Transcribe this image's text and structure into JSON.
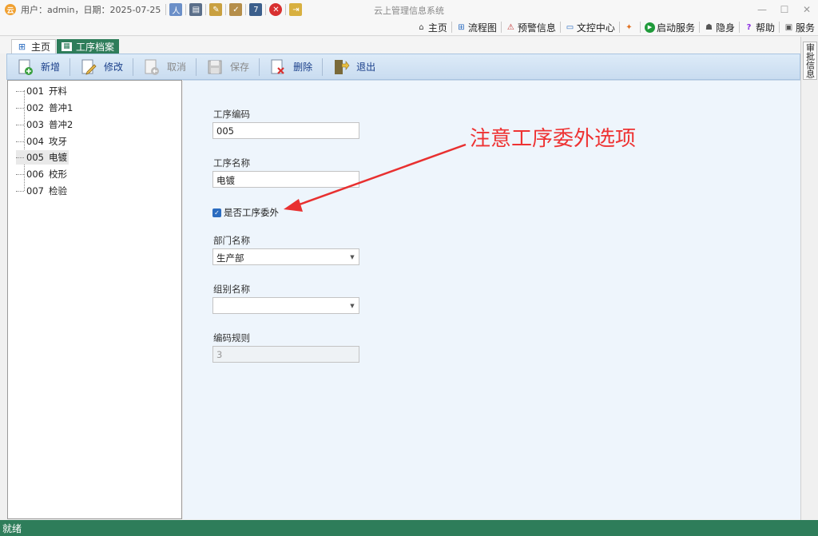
{
  "titlebar": {
    "user_info": "用户：admin，日期：2025-07-25",
    "app_title": "云上管理信息系统"
  },
  "menubar": {
    "items": [
      "主页",
      "流程图",
      "预警信息",
      "文控中心",
      "",
      "启动服务",
      "隐身",
      "帮助",
      "服务"
    ]
  },
  "tabs": {
    "home": "主页",
    "active": "工序档案"
  },
  "toolbar": {
    "new": "新增",
    "edit": "修改",
    "cancel": "取消",
    "save": "保存",
    "delete": "删除",
    "exit": "退出"
  },
  "tree": {
    "items": [
      {
        "code": "001",
        "name": "开料"
      },
      {
        "code": "002",
        "name": "普冲1"
      },
      {
        "code": "003",
        "name": "普冲2"
      },
      {
        "code": "004",
        "name": "攻牙"
      },
      {
        "code": "005",
        "name": "电镀"
      },
      {
        "code": "006",
        "name": "校形"
      },
      {
        "code": "007",
        "name": "检验"
      }
    ]
  },
  "form": {
    "code_label": "工序编码",
    "code_value": "005",
    "name_label": "工序名称",
    "name_value": "电镀",
    "outsource_label": "是否工序委外",
    "outsource_checked": true,
    "dept_label": "部门名称",
    "dept_value": "生产部",
    "group_label": "组别名称",
    "group_value": "",
    "rule_label": "编码规则",
    "rule_value": "3"
  },
  "annotation": {
    "text": "注意工序委外选项",
    "color": "#e83030"
  },
  "right_panel": {
    "audit_label": "审批信息"
  },
  "statusbar": {
    "text": "就绪"
  },
  "colors": {
    "accent_green": "#2e7d5a",
    "toolbar_blue": "#c9dcf0"
  }
}
